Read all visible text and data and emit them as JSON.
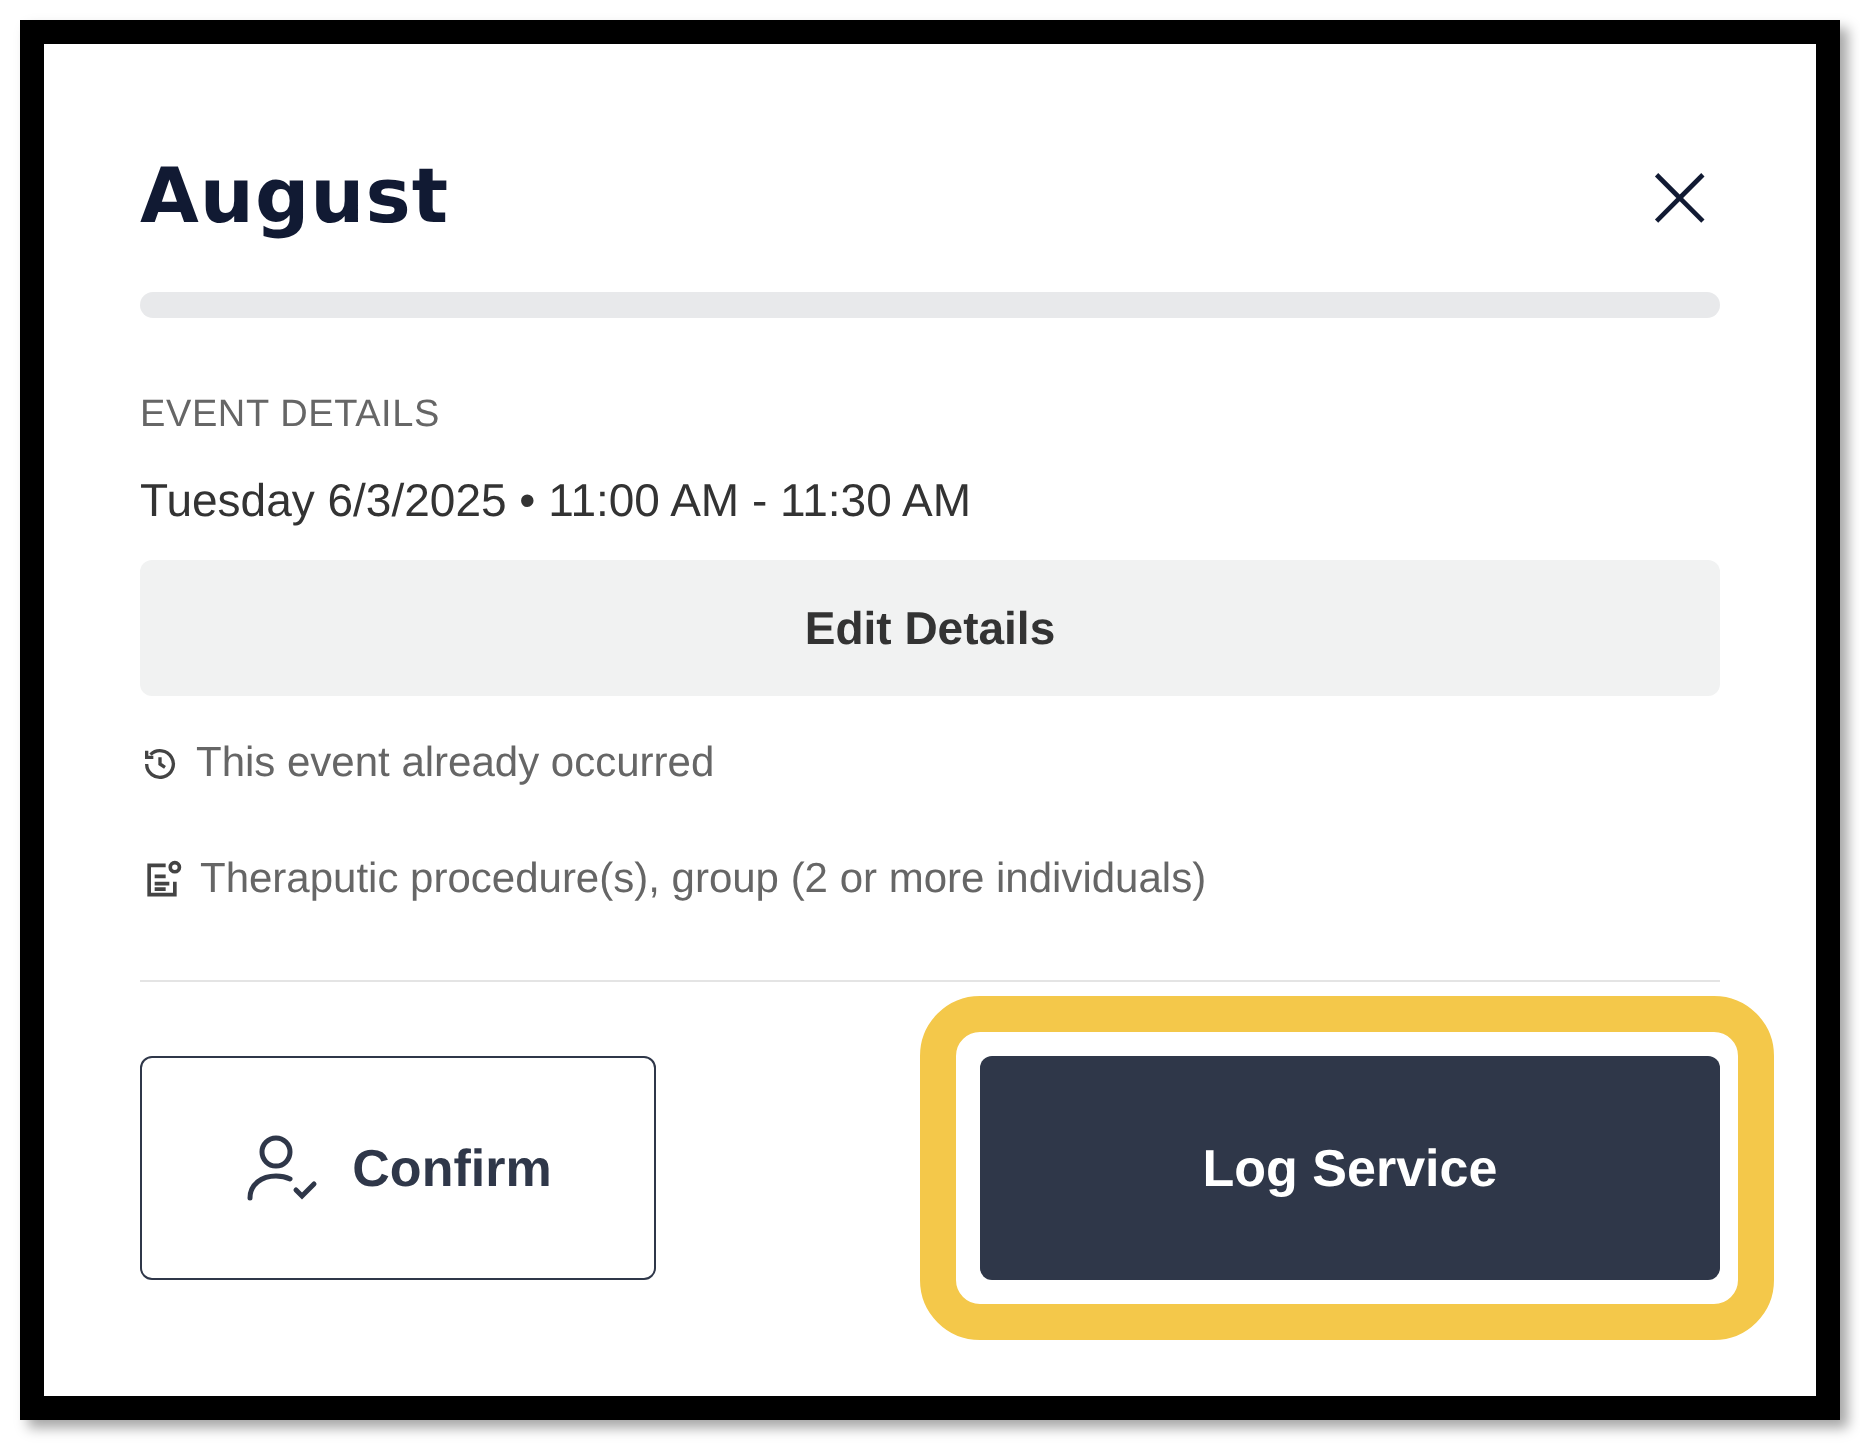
{
  "dialog": {
    "title": "August",
    "close_icon": "×",
    "section_label": "EVENT DETAILS",
    "datetime": "Tuesday 6/3/2025 • 11:00 AM - 11:30 AM",
    "edit_button": "Edit Details",
    "info": [
      {
        "kind": "history",
        "text": "This event already occurred"
      },
      {
        "kind": "note",
        "text": "Theraputic procedure(s), group (2 or more individuals)"
      }
    ],
    "buttons": [
      {
        "kind": "outline",
        "label": "Confirm",
        "highlighted": false
      },
      {
        "kind": "primary",
        "label": "Log Service",
        "highlighted": true
      }
    ]
  }
}
